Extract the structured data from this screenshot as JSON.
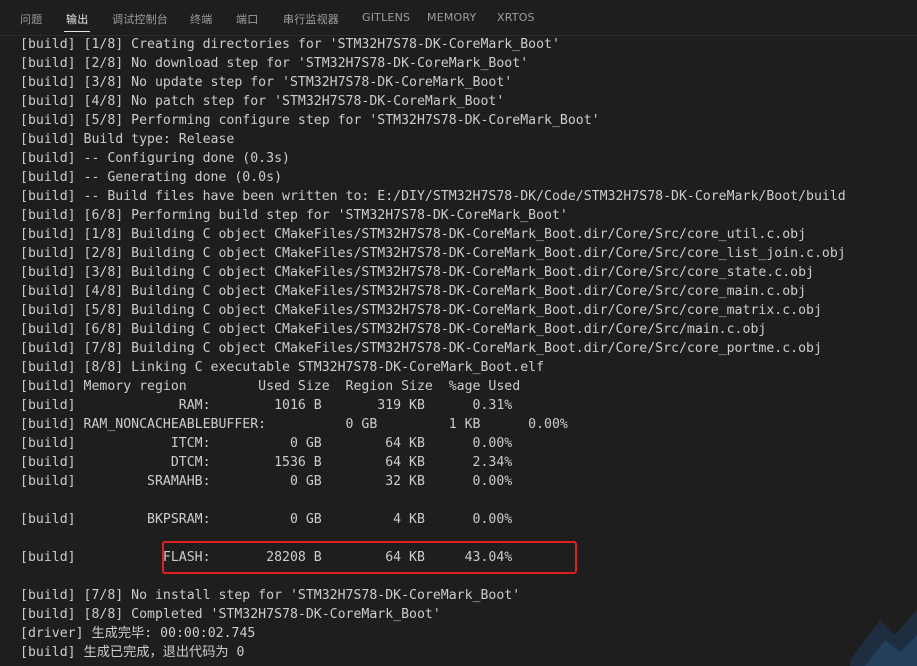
{
  "tabs": [
    {
      "label": "问题",
      "active": false
    },
    {
      "label": "输出",
      "active": true
    },
    {
      "label": "调试控制台",
      "active": false
    },
    {
      "label": "终端",
      "active": false
    },
    {
      "label": "端口",
      "active": false
    },
    {
      "label": "串行监视器",
      "active": false
    },
    {
      "label": "GITLENS",
      "active": false
    },
    {
      "label": "MEMORY",
      "active": false
    },
    {
      "label": "XRTOS",
      "active": false
    }
  ],
  "output_lines": [
    "[build] [1/8] Creating directories for 'STM32H7S78-DK-CoreMark_Boot'",
    "[build] [2/8] No download step for 'STM32H7S78-DK-CoreMark_Boot'",
    "[build] [3/8] No update step for 'STM32H7S78-DK-CoreMark_Boot'",
    "[build] [4/8] No patch step for 'STM32H7S78-DK-CoreMark_Boot'",
    "[build] [5/8] Performing configure step for 'STM32H7S78-DK-CoreMark_Boot'",
    "[build] Build type: Release",
    "[build] -- Configuring done (0.3s)",
    "[build] -- Generating done (0.0s)",
    "[build] -- Build files have been written to: E:/DIY/STM32H7S78-DK/Code/STM32H7S78-DK-CoreMark/Boot/build",
    "[build] [6/8] Performing build step for 'STM32H7S78-DK-CoreMark_Boot'",
    "[build] [1/8] Building C object CMakeFiles/STM32H7S78-DK-CoreMark_Boot.dir/Core/Src/core_util.c.obj",
    "[build] [2/8] Building C object CMakeFiles/STM32H7S78-DK-CoreMark_Boot.dir/Core/Src/core_list_join.c.obj",
    "[build] [3/8] Building C object CMakeFiles/STM32H7S78-DK-CoreMark_Boot.dir/Core/Src/core_state.c.obj",
    "[build] [4/8] Building C object CMakeFiles/STM32H7S78-DK-CoreMark_Boot.dir/Core/Src/core_main.c.obj",
    "[build] [5/8] Building C object CMakeFiles/STM32H7S78-DK-CoreMark_Boot.dir/Core/Src/core_matrix.c.obj",
    "[build] [6/8] Building C object CMakeFiles/STM32H7S78-DK-CoreMark_Boot.dir/Core/Src/main.c.obj",
    "[build] [7/8] Building C object CMakeFiles/STM32H7S78-DK-CoreMark_Boot.dir/Core/Src/core_portme.c.obj",
    "[build] [8/8] Linking C executable STM32H7S78-DK-CoreMark_Boot.elf",
    "[build] Memory region         Used Size  Region Size  %age Used",
    "[build]             RAM:        1016 B       319 KB      0.31%",
    "[build] RAM_NONCACHEABLEBUFFER:          0 GB         1 KB      0.00%",
    "[build]            ITCM:          0 GB        64 KB      0.00%",
    "[build]            DTCM:        1536 B        64 KB      2.34%",
    "[build]         SRAMAHB:          0 GB        32 KB      0.00%",
    "",
    "[build]         BKPSRAM:          0 GB         4 KB      0.00%",
    "",
    "[build]           FLASH:       28208 B        64 KB     43.04%",
    "",
    "[build] [7/8] No install step for 'STM32H7S78-DK-CoreMark_Boot'",
    "[build] [8/8] Completed 'STM32H7S78-DK-CoreMark_Boot'",
    "[driver] 生成完毕: 00:00:02.745",
    "[build] 生成已完成，退出代码为 0"
  ],
  "colors": {
    "background": "#1e1e1e",
    "text": "#cccccc",
    "highlight_border": "#e02020"
  }
}
